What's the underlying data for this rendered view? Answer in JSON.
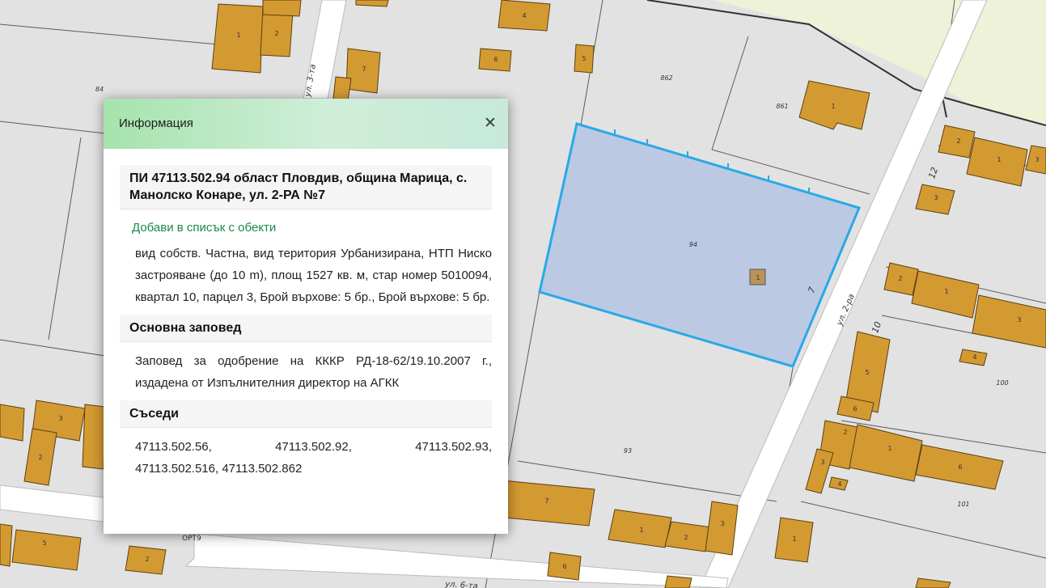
{
  "map": {
    "parcel_numbers": [
      "84",
      "862",
      "861",
      "94",
      "93",
      "100",
      "101",
      "12",
      "10",
      "7"
    ],
    "street_labels": [
      "ул. 3-та",
      "ул. 2-ра",
      "ул. 6-та"
    ],
    "building_numbers": [
      "1",
      "2",
      "3",
      "4",
      "5",
      "6",
      "7"
    ],
    "other_labels": [
      "ОРТ9"
    ],
    "selected_parcel_fill": "#b9c7e3",
    "selected_parcel_stroke": "#29a9e8",
    "building_fill": "#d49a32",
    "road_color": "#ffffff",
    "field_color": "#eef2d8"
  },
  "popup": {
    "title": "Информация",
    "close_icon": "close-icon",
    "parcel_heading": "ПИ 47113.502.94 област Пловдив, община Марица, с. Манолско Конаре, ул. 2-РА №7",
    "add_link": "Добави в списък с обекти",
    "details": "вид собств. Частна, вид територия Урбанизирана, НТП Ниско застрояване (до 10 m), площ 1527 кв. м, стар номер 5010094, квартал 10, парцел 3, Брой върхове: 5 бр., Брой върхове: 5 бр.",
    "order_heading": "Основна заповед",
    "order_text": "Заповед за одобрение на КККР РД-18-62/19.10.2007 г., издадена от Изпълнителния директор на АГКК",
    "neighbors_heading": "Съседи",
    "neighbors": [
      "47113.502.56,",
      "47113.502.92,",
      "47113.502.93,",
      "47113.502.516,",
      "47113.502.862"
    ]
  }
}
